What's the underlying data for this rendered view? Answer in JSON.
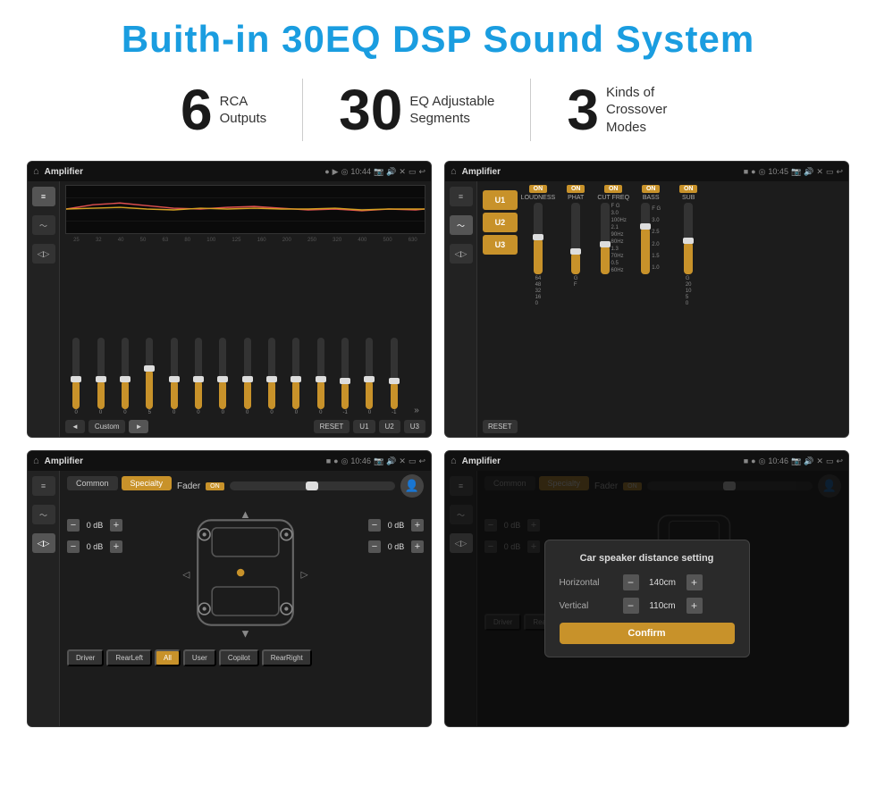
{
  "title": "Buith-in 30EQ DSP Sound System",
  "stats": [
    {
      "number": "6",
      "text": "RCA\nOutputs"
    },
    {
      "number": "30",
      "text": "EQ Adjustable\nSegments"
    },
    {
      "number": "3",
      "text": "Kinds of\nCrossover Modes"
    }
  ],
  "screens": [
    {
      "id": "eq-screen",
      "status_bar": {
        "app": "Amplifier",
        "time": "10:44"
      },
      "type": "equalizer"
    },
    {
      "id": "crossover-screen",
      "status_bar": {
        "app": "Amplifier",
        "time": "10:45"
      },
      "type": "crossover"
    },
    {
      "id": "fader-screen",
      "status_bar": {
        "app": "Amplifier",
        "time": "10:46"
      },
      "type": "fader"
    },
    {
      "id": "dialog-screen",
      "status_bar": {
        "app": "Amplifier",
        "time": "10:46"
      },
      "type": "fader-dialog"
    }
  ],
  "eq": {
    "frequencies": [
      "25",
      "32",
      "40",
      "50",
      "63",
      "80",
      "100",
      "125",
      "160",
      "200",
      "250",
      "320",
      "400",
      "500",
      "630"
    ],
    "values": [
      "0",
      "0",
      "0",
      "5",
      "0",
      "0",
      "0",
      "0",
      "0",
      "0",
      "0",
      "-1",
      "0",
      "-1"
    ],
    "preset": "Custom",
    "buttons": [
      "RESET",
      "U1",
      "U2",
      "U3"
    ]
  },
  "crossover": {
    "presets": [
      "U1",
      "U2",
      "U3"
    ],
    "controls": [
      {
        "label": "LOUDNESS",
        "on": true
      },
      {
        "label": "PHAT",
        "on": true
      },
      {
        "label": "CUT FREQ",
        "on": true
      },
      {
        "label": "BASS",
        "on": true
      },
      {
        "label": "SUB",
        "on": true
      }
    ],
    "reset": "RESET"
  },
  "fader": {
    "tabs": [
      "Common",
      "Specialty"
    ],
    "active_tab": "Specialty",
    "fader_label": "Fader",
    "fader_on": "ON",
    "db_values": [
      "0 dB",
      "0 dB",
      "0 dB",
      "0 dB"
    ],
    "bottom_buttons": [
      "Driver",
      "RearLeft",
      "All",
      "User",
      "Copilot",
      "RearRight"
    ]
  },
  "dialog": {
    "title": "Car speaker distance setting",
    "horizontal_label": "Horizontal",
    "horizontal_value": "140cm",
    "vertical_label": "Vertical",
    "vertical_value": "110cm",
    "confirm": "Confirm"
  }
}
